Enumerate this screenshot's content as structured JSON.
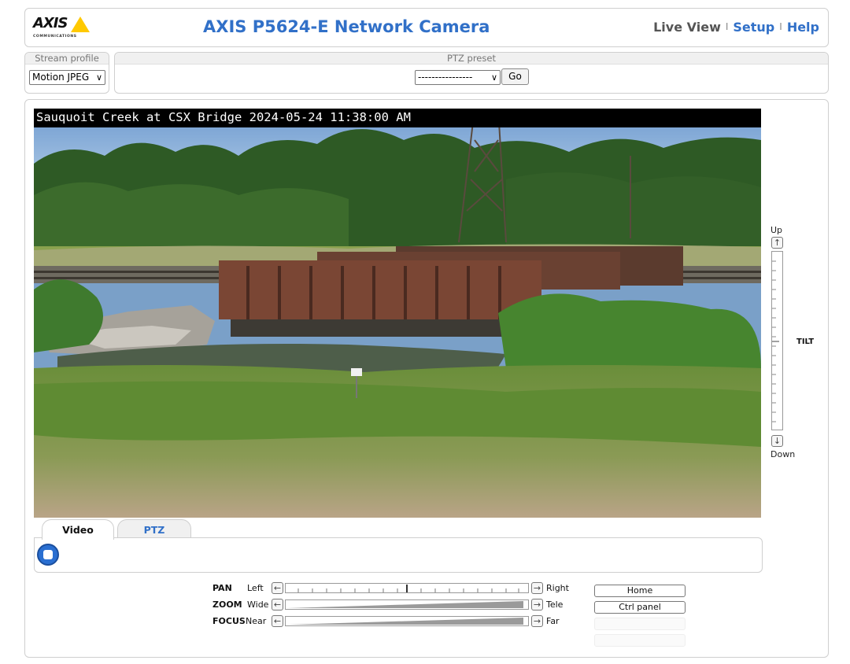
{
  "header": {
    "logo_text": "AXIS",
    "logo_subtext": "COMMUNICATIONS",
    "title": "AXIS P5624-E Network Camera",
    "nav": {
      "live_view": "Live View",
      "setup": "Setup",
      "help": "Help",
      "separator": "I"
    }
  },
  "stream_profile": {
    "label": "Stream profile",
    "value": "Motion JPEG"
  },
  "ptz_preset": {
    "label": "PTZ preset",
    "value": "----------------",
    "go_label": "Go"
  },
  "video": {
    "overlay_text": "Sauquoit Creek at CSX Bridge 2024-05-24 11:38:00 AM",
    "scene_icon": "camera-video-feed"
  },
  "tilt": {
    "label": "TILT",
    "up": "Up",
    "down": "Down",
    "up_icon": "arrow-up-icon",
    "down_icon": "arrow-down-icon"
  },
  "tabs": [
    {
      "label": "Video",
      "active": true
    },
    {
      "label": "PTZ",
      "active": false
    }
  ],
  "controls": {
    "pan": {
      "label": "PAN",
      "left": "Left",
      "right": "Right"
    },
    "zoom": {
      "label": "ZOOM",
      "left": "Wide",
      "right": "Tele"
    },
    "focus": {
      "label": "FOCUS",
      "left": "Near",
      "right": "Far"
    },
    "home_label": "Home",
    "ctrl_panel_label": "Ctrl panel"
  },
  "colors": {
    "accent": "#3170c8",
    "logo_yellow": "#ffc900",
    "stop_button": "#2a6fd1"
  }
}
